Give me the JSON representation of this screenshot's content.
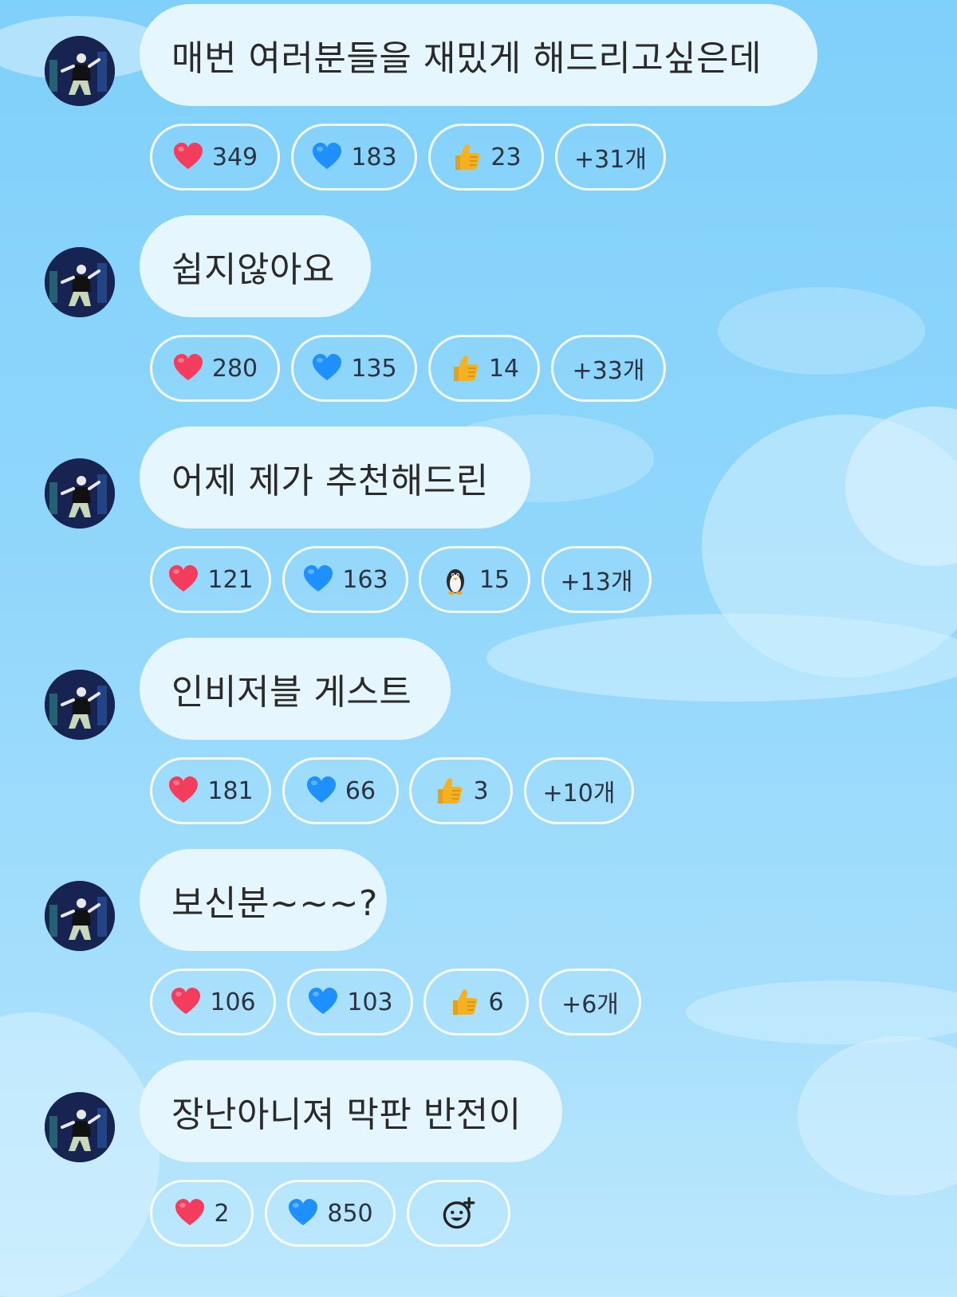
{
  "messages": [
    {
      "text": "매번 여러분들을 재밌게 해드리고싶은데",
      "reactions": [
        {
          "icon": "red-heart-icon",
          "count": "349"
        },
        {
          "icon": "blue-heart-icon",
          "count": "183"
        },
        {
          "icon": "thumbs-up-icon",
          "count": "23"
        }
      ],
      "more": "+31개"
    },
    {
      "text": "쉽지않아요",
      "reactions": [
        {
          "icon": "red-heart-icon",
          "count": "280"
        },
        {
          "icon": "blue-heart-icon",
          "count": "135"
        },
        {
          "icon": "thumbs-up-icon",
          "count": "14"
        }
      ],
      "more": "+33개"
    },
    {
      "text": "어제 제가 추천해드린",
      "reactions": [
        {
          "icon": "red-heart-icon",
          "count": "121"
        },
        {
          "icon": "blue-heart-icon",
          "count": "163"
        },
        {
          "icon": "penguin-icon",
          "count": "15"
        }
      ],
      "more": "+13개"
    },
    {
      "text": "인비저블 게스트",
      "reactions": [
        {
          "icon": "red-heart-icon",
          "count": "181"
        },
        {
          "icon": "blue-heart-icon",
          "count": "66"
        },
        {
          "icon": "thumbs-up-icon",
          "count": "3"
        }
      ],
      "more": "+10개"
    },
    {
      "text": "보신분~~~?",
      "reactions": [
        {
          "icon": "red-heart-icon",
          "count": "106"
        },
        {
          "icon": "blue-heart-icon",
          "count": "103"
        },
        {
          "icon": "thumbs-up-icon",
          "count": "6"
        }
      ],
      "more": "+6개"
    },
    {
      "text": "장난아니져 막판 반전이",
      "reactions": [
        {
          "icon": "red-heart-icon",
          "count": "2"
        },
        {
          "icon": "blue-heart-icon",
          "count": "850"
        }
      ],
      "add_reaction_icon": "add-reaction-smiley-icon"
    }
  ],
  "colors": {
    "red_heart": "#f43d5d",
    "blue_heart": "#1e90ff",
    "thumb": "#f4b223",
    "bubble": "#e6f6fe",
    "text": "#2a2a2a"
  }
}
